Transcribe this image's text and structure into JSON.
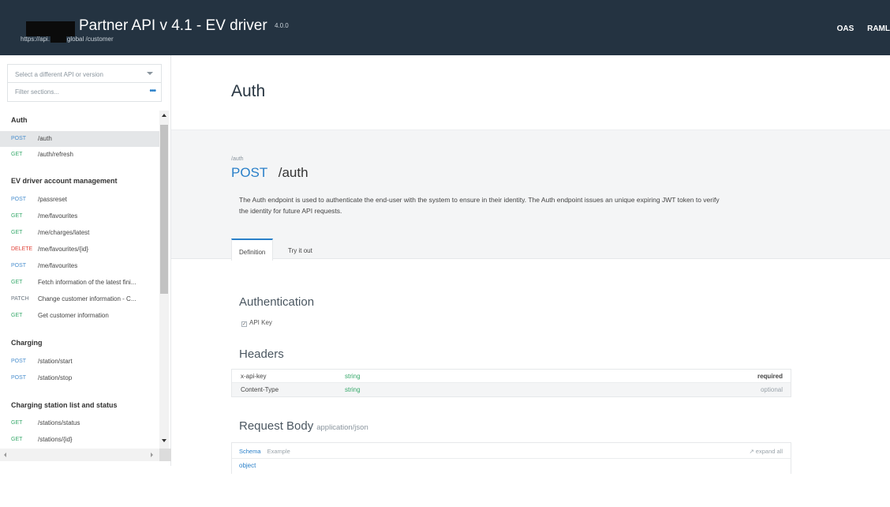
{
  "header": {
    "title": "Partner API v 4.1 - EV driver",
    "version": "4.0.0",
    "base_url_prefix": "https://api.",
    "base_url_suffix": "global /customer",
    "links": [
      "OAS",
      "RAML"
    ]
  },
  "sidebar": {
    "select_placeholder": "Select a different API or version",
    "filter_placeholder": "Filter sections...",
    "filter_menu_icon": "more-dots-icon",
    "sections": [
      {
        "title": "Auth",
        "items": [
          {
            "method": "POST",
            "label": "/auth",
            "active": true
          },
          {
            "method": "GET",
            "label": "/auth/refresh"
          }
        ]
      },
      {
        "title": "EV driver account management",
        "items": [
          {
            "method": "POST",
            "label": "/passreset"
          },
          {
            "method": "GET",
            "label": "/me/favourites"
          },
          {
            "method": "GET",
            "label": "/me/charges/latest"
          },
          {
            "method": "DELETE",
            "label": "/me/favourites/{id}"
          },
          {
            "method": "POST",
            "label": "/me/favourites"
          },
          {
            "method": "GET",
            "label": "Fetch information of the latest fini..."
          },
          {
            "method": "PATCH",
            "label": "Change customer information - C..."
          },
          {
            "method": "GET",
            "label": "Get customer information"
          }
        ]
      },
      {
        "title": "Charging",
        "items": [
          {
            "method": "POST",
            "label": "/station/start"
          },
          {
            "method": "POST",
            "label": "/station/stop"
          }
        ]
      },
      {
        "title": "Charging station list and status",
        "items": [
          {
            "method": "GET",
            "label": "/stations/status"
          },
          {
            "method": "GET",
            "label": "/stations/{id}"
          }
        ]
      }
    ]
  },
  "main": {
    "page_title": "Auth",
    "endpoint": {
      "path_small": "/auth",
      "method": "POST",
      "path": "/auth",
      "description": "The Auth endpoint is used to authenticate the end-user with the system to ensure in their identity. The Auth endpoint issues an unique expiring JWT token to verify the identity for future API requests."
    },
    "tabs": [
      "Definition",
      "Try it out"
    ],
    "authentication": {
      "title": "Authentication",
      "item": "API Key"
    },
    "headers": {
      "title": "Headers",
      "rows": [
        {
          "name": "x-api-key",
          "type": "string",
          "requirement": "required"
        },
        {
          "name": "Content-Type",
          "type": "string",
          "requirement": "optional"
        }
      ]
    },
    "request_body": {
      "title": "Request Body",
      "content_type": "application/json",
      "tab_schema": "Schema",
      "tab_example": "Example",
      "expand_all": "↗ expand all",
      "root_type": "object"
    }
  },
  "colors": {
    "header_bg": "#243341",
    "accent": "#2a80c9",
    "get": "#37a96b",
    "delete": "#e0443a",
    "panel_bg": "#f4f5f6"
  }
}
